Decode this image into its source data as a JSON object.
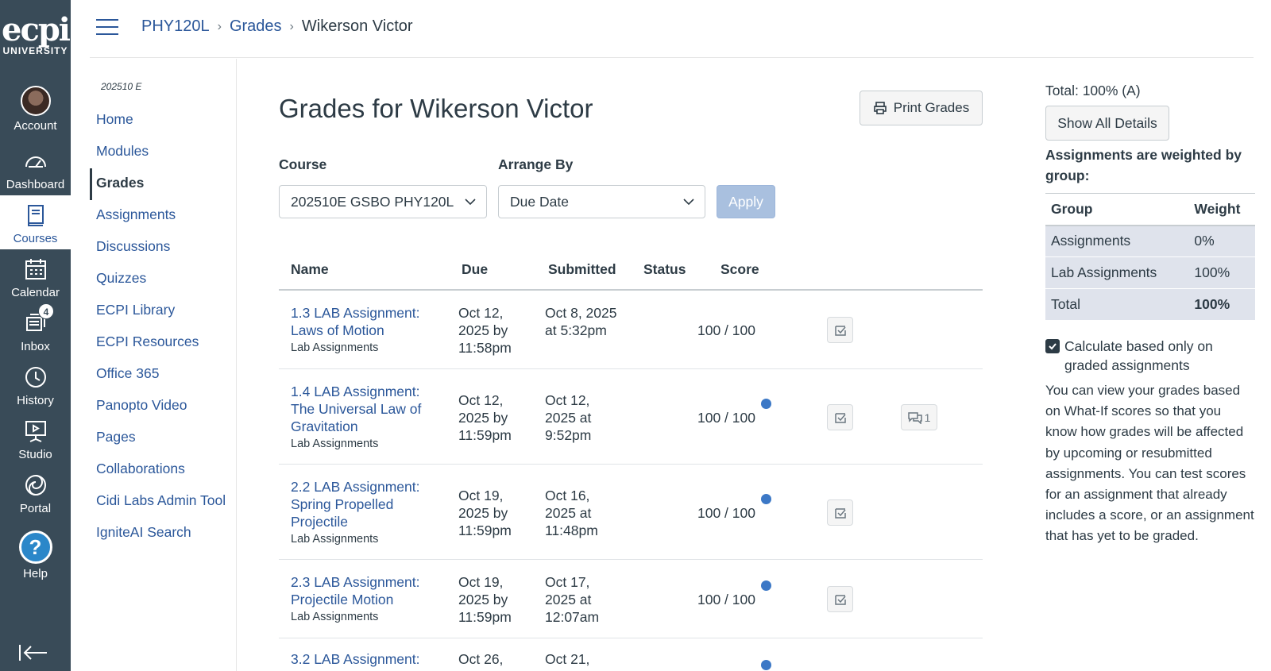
{
  "logo": {
    "mark": "ecpi",
    "sub": "UNIVERSITY"
  },
  "global_nav": [
    {
      "label": "Account"
    },
    {
      "label": "Dashboard"
    },
    {
      "label": "Courses"
    },
    {
      "label": "Calendar"
    },
    {
      "label": "Inbox",
      "badge": "4"
    },
    {
      "label": "History"
    },
    {
      "label": "Studio"
    },
    {
      "label": "Portal"
    },
    {
      "label": "Help",
      "glyph": "?"
    }
  ],
  "breadcrumb": {
    "course": "PHY120L",
    "section": "Grades",
    "current": "Wikerson Victor",
    "sep": "›"
  },
  "course_nav": {
    "term": "202510 E",
    "items": [
      "Home",
      "Modules",
      "Grades",
      "Assignments",
      "Discussions",
      "Quizzes",
      "ECPI Library",
      "ECPI Resources",
      "Office 365",
      "Panopto Video",
      "Pages",
      "Collaborations",
      "Cidi Labs Admin Tool",
      "IgniteAI Search"
    ]
  },
  "main": {
    "title": "Grades for Wikerson Victor",
    "print_label": "Print Grades",
    "course_label": "Course",
    "course_value": "202510E GSBO PHY120L",
    "arrange_label": "Arrange By",
    "arrange_value": "Due Date",
    "apply_label": "Apply",
    "columns": [
      "Name",
      "Due",
      "Submitted",
      "Status",
      "Score"
    ],
    "rows": [
      {
        "name": "1.3 LAB Assignment: Laws of Motion",
        "group": "Lab Assignments",
        "due": "Oct 12, 2025 by 11:58pm",
        "submitted": "Oct 8, 2025 at 5:32pm",
        "score": "100 / 100"
      },
      {
        "name": "1.4 LAB Assignment: The Universal Law of Gravitation",
        "group": "Lab Assignments",
        "due": "Oct 12, 2025 by 11:59pm",
        "submitted": "Oct 12, 2025 at 9:52pm",
        "score": "100 / 100",
        "comments": "1"
      },
      {
        "name": "2.2 LAB Assignment: Spring Propelled Projectile",
        "group": "Lab Assignments",
        "due": "Oct 19, 2025 by 11:59pm",
        "submitted": "Oct 16, 2025 at 11:48pm",
        "score": "100 / 100"
      },
      {
        "name": "2.3 LAB Assignment: Projectile Motion",
        "group": "Lab Assignments",
        "due": "Oct 19, 2025 by 11:59pm",
        "submitted": "Oct 17, 2025 at 12:07am",
        "score": "100 / 100"
      },
      {
        "name": "3.2 LAB Assignment:",
        "due": "Oct 26,",
        "submitted": "Oct 21,"
      }
    ]
  },
  "sidebar": {
    "total": "Total: 100% (A)",
    "show_details": "Show All Details",
    "weighted_note": "Assignments are weighted by group:",
    "weight_headers": [
      "Group",
      "Weight"
    ],
    "weights": [
      {
        "group": "Assignments",
        "weight": "0%"
      },
      {
        "group": "Lab Assignments",
        "weight": "100%"
      },
      {
        "group": "Total",
        "weight": "100%"
      }
    ],
    "calc_label": "Calculate based only on graded assignments",
    "whatif_text": "You can view your grades based on What-If scores so that you know how grades will be affected by upcoming or resubmitted assignments. You can test scores for an assignment that already includes a score, or an assignment that has yet to be graded."
  },
  "colors": {
    "nav_bg": "#394b58",
    "link": "#2b579a",
    "unread_dot": "#3c78c6",
    "apply_disabled": "#a9c0df"
  }
}
